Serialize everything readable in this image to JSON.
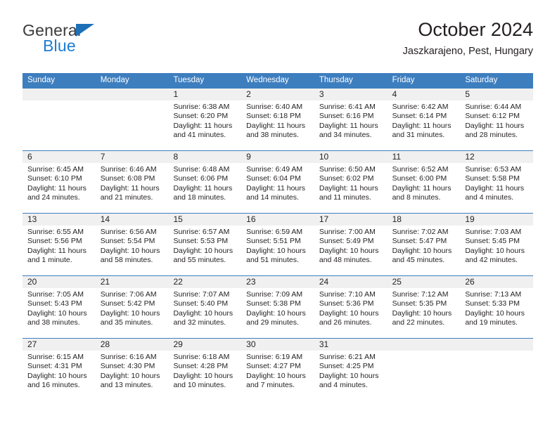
{
  "brand": {
    "name_top": "General",
    "name_bottom": "Blue",
    "triangle_color": "#1d70b8",
    "blue_color": "#1d7dd1"
  },
  "header": {
    "title": "October 2024",
    "subtitle": "Jaszkarajeno, Pest, Hungary",
    "header_bg": "#3d7ebf",
    "daynum_bg": "#f0f0f0"
  },
  "weekdays": [
    "Sunday",
    "Monday",
    "Tuesday",
    "Wednesday",
    "Thursday",
    "Friday",
    "Saturday"
  ],
  "weeks": [
    [
      {
        "day": "",
        "sunrise": "",
        "sunset": "",
        "daylight1": "",
        "daylight2": ""
      },
      {
        "day": "",
        "sunrise": "",
        "sunset": "",
        "daylight1": "",
        "daylight2": ""
      },
      {
        "day": "1",
        "sunrise": "Sunrise: 6:38 AM",
        "sunset": "Sunset: 6:20 PM",
        "daylight1": "Daylight: 11 hours",
        "daylight2": "and 41 minutes."
      },
      {
        "day": "2",
        "sunrise": "Sunrise: 6:40 AM",
        "sunset": "Sunset: 6:18 PM",
        "daylight1": "Daylight: 11 hours",
        "daylight2": "and 38 minutes."
      },
      {
        "day": "3",
        "sunrise": "Sunrise: 6:41 AM",
        "sunset": "Sunset: 6:16 PM",
        "daylight1": "Daylight: 11 hours",
        "daylight2": "and 34 minutes."
      },
      {
        "day": "4",
        "sunrise": "Sunrise: 6:42 AM",
        "sunset": "Sunset: 6:14 PM",
        "daylight1": "Daylight: 11 hours",
        "daylight2": "and 31 minutes."
      },
      {
        "day": "5",
        "sunrise": "Sunrise: 6:44 AM",
        "sunset": "Sunset: 6:12 PM",
        "daylight1": "Daylight: 11 hours",
        "daylight2": "and 28 minutes."
      }
    ],
    [
      {
        "day": "6",
        "sunrise": "Sunrise: 6:45 AM",
        "sunset": "Sunset: 6:10 PM",
        "daylight1": "Daylight: 11 hours",
        "daylight2": "and 24 minutes."
      },
      {
        "day": "7",
        "sunrise": "Sunrise: 6:46 AM",
        "sunset": "Sunset: 6:08 PM",
        "daylight1": "Daylight: 11 hours",
        "daylight2": "and 21 minutes."
      },
      {
        "day": "8",
        "sunrise": "Sunrise: 6:48 AM",
        "sunset": "Sunset: 6:06 PM",
        "daylight1": "Daylight: 11 hours",
        "daylight2": "and 18 minutes."
      },
      {
        "day": "9",
        "sunrise": "Sunrise: 6:49 AM",
        "sunset": "Sunset: 6:04 PM",
        "daylight1": "Daylight: 11 hours",
        "daylight2": "and 14 minutes."
      },
      {
        "day": "10",
        "sunrise": "Sunrise: 6:50 AM",
        "sunset": "Sunset: 6:02 PM",
        "daylight1": "Daylight: 11 hours",
        "daylight2": "and 11 minutes."
      },
      {
        "day": "11",
        "sunrise": "Sunrise: 6:52 AM",
        "sunset": "Sunset: 6:00 PM",
        "daylight1": "Daylight: 11 hours",
        "daylight2": "and 8 minutes."
      },
      {
        "day": "12",
        "sunrise": "Sunrise: 6:53 AM",
        "sunset": "Sunset: 5:58 PM",
        "daylight1": "Daylight: 11 hours",
        "daylight2": "and 4 minutes."
      }
    ],
    [
      {
        "day": "13",
        "sunrise": "Sunrise: 6:55 AM",
        "sunset": "Sunset: 5:56 PM",
        "daylight1": "Daylight: 11 hours",
        "daylight2": "and 1 minute."
      },
      {
        "day": "14",
        "sunrise": "Sunrise: 6:56 AM",
        "sunset": "Sunset: 5:54 PM",
        "daylight1": "Daylight: 10 hours",
        "daylight2": "and 58 minutes."
      },
      {
        "day": "15",
        "sunrise": "Sunrise: 6:57 AM",
        "sunset": "Sunset: 5:53 PM",
        "daylight1": "Daylight: 10 hours",
        "daylight2": "and 55 minutes."
      },
      {
        "day": "16",
        "sunrise": "Sunrise: 6:59 AM",
        "sunset": "Sunset: 5:51 PM",
        "daylight1": "Daylight: 10 hours",
        "daylight2": "and 51 minutes."
      },
      {
        "day": "17",
        "sunrise": "Sunrise: 7:00 AM",
        "sunset": "Sunset: 5:49 PM",
        "daylight1": "Daylight: 10 hours",
        "daylight2": "and 48 minutes."
      },
      {
        "day": "18",
        "sunrise": "Sunrise: 7:02 AM",
        "sunset": "Sunset: 5:47 PM",
        "daylight1": "Daylight: 10 hours",
        "daylight2": "and 45 minutes."
      },
      {
        "day": "19",
        "sunrise": "Sunrise: 7:03 AM",
        "sunset": "Sunset: 5:45 PM",
        "daylight1": "Daylight: 10 hours",
        "daylight2": "and 42 minutes."
      }
    ],
    [
      {
        "day": "20",
        "sunrise": "Sunrise: 7:05 AM",
        "sunset": "Sunset: 5:43 PM",
        "daylight1": "Daylight: 10 hours",
        "daylight2": "and 38 minutes."
      },
      {
        "day": "21",
        "sunrise": "Sunrise: 7:06 AM",
        "sunset": "Sunset: 5:42 PM",
        "daylight1": "Daylight: 10 hours",
        "daylight2": "and 35 minutes."
      },
      {
        "day": "22",
        "sunrise": "Sunrise: 7:07 AM",
        "sunset": "Sunset: 5:40 PM",
        "daylight1": "Daylight: 10 hours",
        "daylight2": "and 32 minutes."
      },
      {
        "day": "23",
        "sunrise": "Sunrise: 7:09 AM",
        "sunset": "Sunset: 5:38 PM",
        "daylight1": "Daylight: 10 hours",
        "daylight2": "and 29 minutes."
      },
      {
        "day": "24",
        "sunrise": "Sunrise: 7:10 AM",
        "sunset": "Sunset: 5:36 PM",
        "daylight1": "Daylight: 10 hours",
        "daylight2": "and 26 minutes."
      },
      {
        "day": "25",
        "sunrise": "Sunrise: 7:12 AM",
        "sunset": "Sunset: 5:35 PM",
        "daylight1": "Daylight: 10 hours",
        "daylight2": "and 22 minutes."
      },
      {
        "day": "26",
        "sunrise": "Sunrise: 7:13 AM",
        "sunset": "Sunset: 5:33 PM",
        "daylight1": "Daylight: 10 hours",
        "daylight2": "and 19 minutes."
      }
    ],
    [
      {
        "day": "27",
        "sunrise": "Sunrise: 6:15 AM",
        "sunset": "Sunset: 4:31 PM",
        "daylight1": "Daylight: 10 hours",
        "daylight2": "and 16 minutes."
      },
      {
        "day": "28",
        "sunrise": "Sunrise: 6:16 AM",
        "sunset": "Sunset: 4:30 PM",
        "daylight1": "Daylight: 10 hours",
        "daylight2": "and 13 minutes."
      },
      {
        "day": "29",
        "sunrise": "Sunrise: 6:18 AM",
        "sunset": "Sunset: 4:28 PM",
        "daylight1": "Daylight: 10 hours",
        "daylight2": "and 10 minutes."
      },
      {
        "day": "30",
        "sunrise": "Sunrise: 6:19 AM",
        "sunset": "Sunset: 4:27 PM",
        "daylight1": "Daylight: 10 hours",
        "daylight2": "and 7 minutes."
      },
      {
        "day": "31",
        "sunrise": "Sunrise: 6:21 AM",
        "sunset": "Sunset: 4:25 PM",
        "daylight1": "Daylight: 10 hours",
        "daylight2": "and 4 minutes."
      },
      {
        "day": "",
        "sunrise": "",
        "sunset": "",
        "daylight1": "",
        "daylight2": ""
      },
      {
        "day": "",
        "sunrise": "",
        "sunset": "",
        "daylight1": "",
        "daylight2": ""
      }
    ]
  ]
}
